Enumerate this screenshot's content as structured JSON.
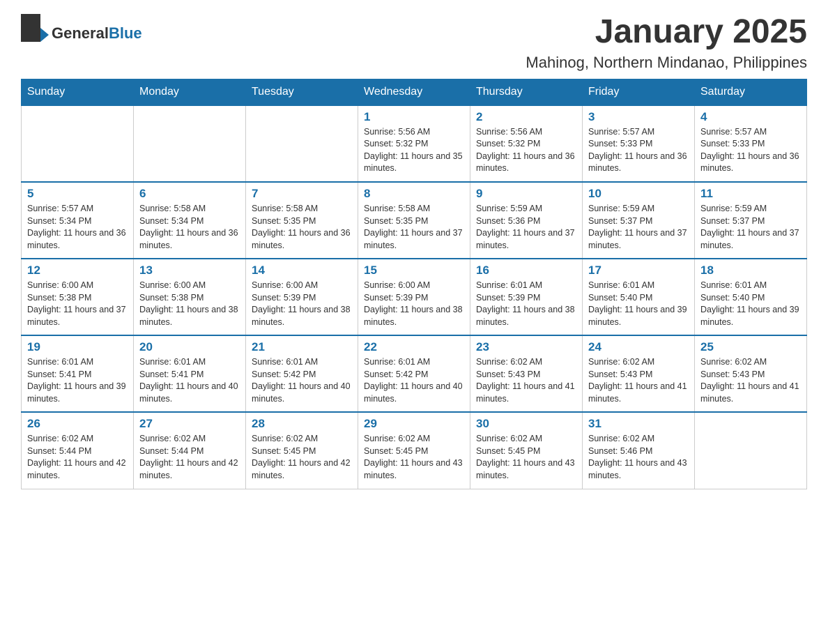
{
  "header": {
    "logo_general": "General",
    "logo_blue": "Blue",
    "month_title": "January 2025",
    "location": "Mahinog, Northern Mindanao, Philippines"
  },
  "days_of_week": [
    "Sunday",
    "Monday",
    "Tuesday",
    "Wednesday",
    "Thursday",
    "Friday",
    "Saturday"
  ],
  "weeks": [
    [
      {
        "day": "",
        "sunrise": "",
        "sunset": "",
        "daylight": ""
      },
      {
        "day": "",
        "sunrise": "",
        "sunset": "",
        "daylight": ""
      },
      {
        "day": "",
        "sunrise": "",
        "sunset": "",
        "daylight": ""
      },
      {
        "day": "1",
        "sunrise": "Sunrise: 5:56 AM",
        "sunset": "Sunset: 5:32 PM",
        "daylight": "Daylight: 11 hours and 35 minutes."
      },
      {
        "day": "2",
        "sunrise": "Sunrise: 5:56 AM",
        "sunset": "Sunset: 5:32 PM",
        "daylight": "Daylight: 11 hours and 36 minutes."
      },
      {
        "day": "3",
        "sunrise": "Sunrise: 5:57 AM",
        "sunset": "Sunset: 5:33 PM",
        "daylight": "Daylight: 11 hours and 36 minutes."
      },
      {
        "day": "4",
        "sunrise": "Sunrise: 5:57 AM",
        "sunset": "Sunset: 5:33 PM",
        "daylight": "Daylight: 11 hours and 36 minutes."
      }
    ],
    [
      {
        "day": "5",
        "sunrise": "Sunrise: 5:57 AM",
        "sunset": "Sunset: 5:34 PM",
        "daylight": "Daylight: 11 hours and 36 minutes."
      },
      {
        "day": "6",
        "sunrise": "Sunrise: 5:58 AM",
        "sunset": "Sunset: 5:34 PM",
        "daylight": "Daylight: 11 hours and 36 minutes."
      },
      {
        "day": "7",
        "sunrise": "Sunrise: 5:58 AM",
        "sunset": "Sunset: 5:35 PM",
        "daylight": "Daylight: 11 hours and 36 minutes."
      },
      {
        "day": "8",
        "sunrise": "Sunrise: 5:58 AM",
        "sunset": "Sunset: 5:35 PM",
        "daylight": "Daylight: 11 hours and 37 minutes."
      },
      {
        "day": "9",
        "sunrise": "Sunrise: 5:59 AM",
        "sunset": "Sunset: 5:36 PM",
        "daylight": "Daylight: 11 hours and 37 minutes."
      },
      {
        "day": "10",
        "sunrise": "Sunrise: 5:59 AM",
        "sunset": "Sunset: 5:37 PM",
        "daylight": "Daylight: 11 hours and 37 minutes."
      },
      {
        "day": "11",
        "sunrise": "Sunrise: 5:59 AM",
        "sunset": "Sunset: 5:37 PM",
        "daylight": "Daylight: 11 hours and 37 minutes."
      }
    ],
    [
      {
        "day": "12",
        "sunrise": "Sunrise: 6:00 AM",
        "sunset": "Sunset: 5:38 PM",
        "daylight": "Daylight: 11 hours and 37 minutes."
      },
      {
        "day": "13",
        "sunrise": "Sunrise: 6:00 AM",
        "sunset": "Sunset: 5:38 PM",
        "daylight": "Daylight: 11 hours and 38 minutes."
      },
      {
        "day": "14",
        "sunrise": "Sunrise: 6:00 AM",
        "sunset": "Sunset: 5:39 PM",
        "daylight": "Daylight: 11 hours and 38 minutes."
      },
      {
        "day": "15",
        "sunrise": "Sunrise: 6:00 AM",
        "sunset": "Sunset: 5:39 PM",
        "daylight": "Daylight: 11 hours and 38 minutes."
      },
      {
        "day": "16",
        "sunrise": "Sunrise: 6:01 AM",
        "sunset": "Sunset: 5:39 PM",
        "daylight": "Daylight: 11 hours and 38 minutes."
      },
      {
        "day": "17",
        "sunrise": "Sunrise: 6:01 AM",
        "sunset": "Sunset: 5:40 PM",
        "daylight": "Daylight: 11 hours and 39 minutes."
      },
      {
        "day": "18",
        "sunrise": "Sunrise: 6:01 AM",
        "sunset": "Sunset: 5:40 PM",
        "daylight": "Daylight: 11 hours and 39 minutes."
      }
    ],
    [
      {
        "day": "19",
        "sunrise": "Sunrise: 6:01 AM",
        "sunset": "Sunset: 5:41 PM",
        "daylight": "Daylight: 11 hours and 39 minutes."
      },
      {
        "day": "20",
        "sunrise": "Sunrise: 6:01 AM",
        "sunset": "Sunset: 5:41 PM",
        "daylight": "Daylight: 11 hours and 40 minutes."
      },
      {
        "day": "21",
        "sunrise": "Sunrise: 6:01 AM",
        "sunset": "Sunset: 5:42 PM",
        "daylight": "Daylight: 11 hours and 40 minutes."
      },
      {
        "day": "22",
        "sunrise": "Sunrise: 6:01 AM",
        "sunset": "Sunset: 5:42 PM",
        "daylight": "Daylight: 11 hours and 40 minutes."
      },
      {
        "day": "23",
        "sunrise": "Sunrise: 6:02 AM",
        "sunset": "Sunset: 5:43 PM",
        "daylight": "Daylight: 11 hours and 41 minutes."
      },
      {
        "day": "24",
        "sunrise": "Sunrise: 6:02 AM",
        "sunset": "Sunset: 5:43 PM",
        "daylight": "Daylight: 11 hours and 41 minutes."
      },
      {
        "day": "25",
        "sunrise": "Sunrise: 6:02 AM",
        "sunset": "Sunset: 5:43 PM",
        "daylight": "Daylight: 11 hours and 41 minutes."
      }
    ],
    [
      {
        "day": "26",
        "sunrise": "Sunrise: 6:02 AM",
        "sunset": "Sunset: 5:44 PM",
        "daylight": "Daylight: 11 hours and 42 minutes."
      },
      {
        "day": "27",
        "sunrise": "Sunrise: 6:02 AM",
        "sunset": "Sunset: 5:44 PM",
        "daylight": "Daylight: 11 hours and 42 minutes."
      },
      {
        "day": "28",
        "sunrise": "Sunrise: 6:02 AM",
        "sunset": "Sunset: 5:45 PM",
        "daylight": "Daylight: 11 hours and 42 minutes."
      },
      {
        "day": "29",
        "sunrise": "Sunrise: 6:02 AM",
        "sunset": "Sunset: 5:45 PM",
        "daylight": "Daylight: 11 hours and 43 minutes."
      },
      {
        "day": "30",
        "sunrise": "Sunrise: 6:02 AM",
        "sunset": "Sunset: 5:45 PM",
        "daylight": "Daylight: 11 hours and 43 minutes."
      },
      {
        "day": "31",
        "sunrise": "Sunrise: 6:02 AM",
        "sunset": "Sunset: 5:46 PM",
        "daylight": "Daylight: 11 hours and 43 minutes."
      },
      {
        "day": "",
        "sunrise": "",
        "sunset": "",
        "daylight": ""
      }
    ]
  ],
  "colors": {
    "header_bg": "#1a6fa8",
    "header_text": "#ffffff",
    "day_number": "#1a6fa8",
    "border": "#1a6fa8"
  }
}
